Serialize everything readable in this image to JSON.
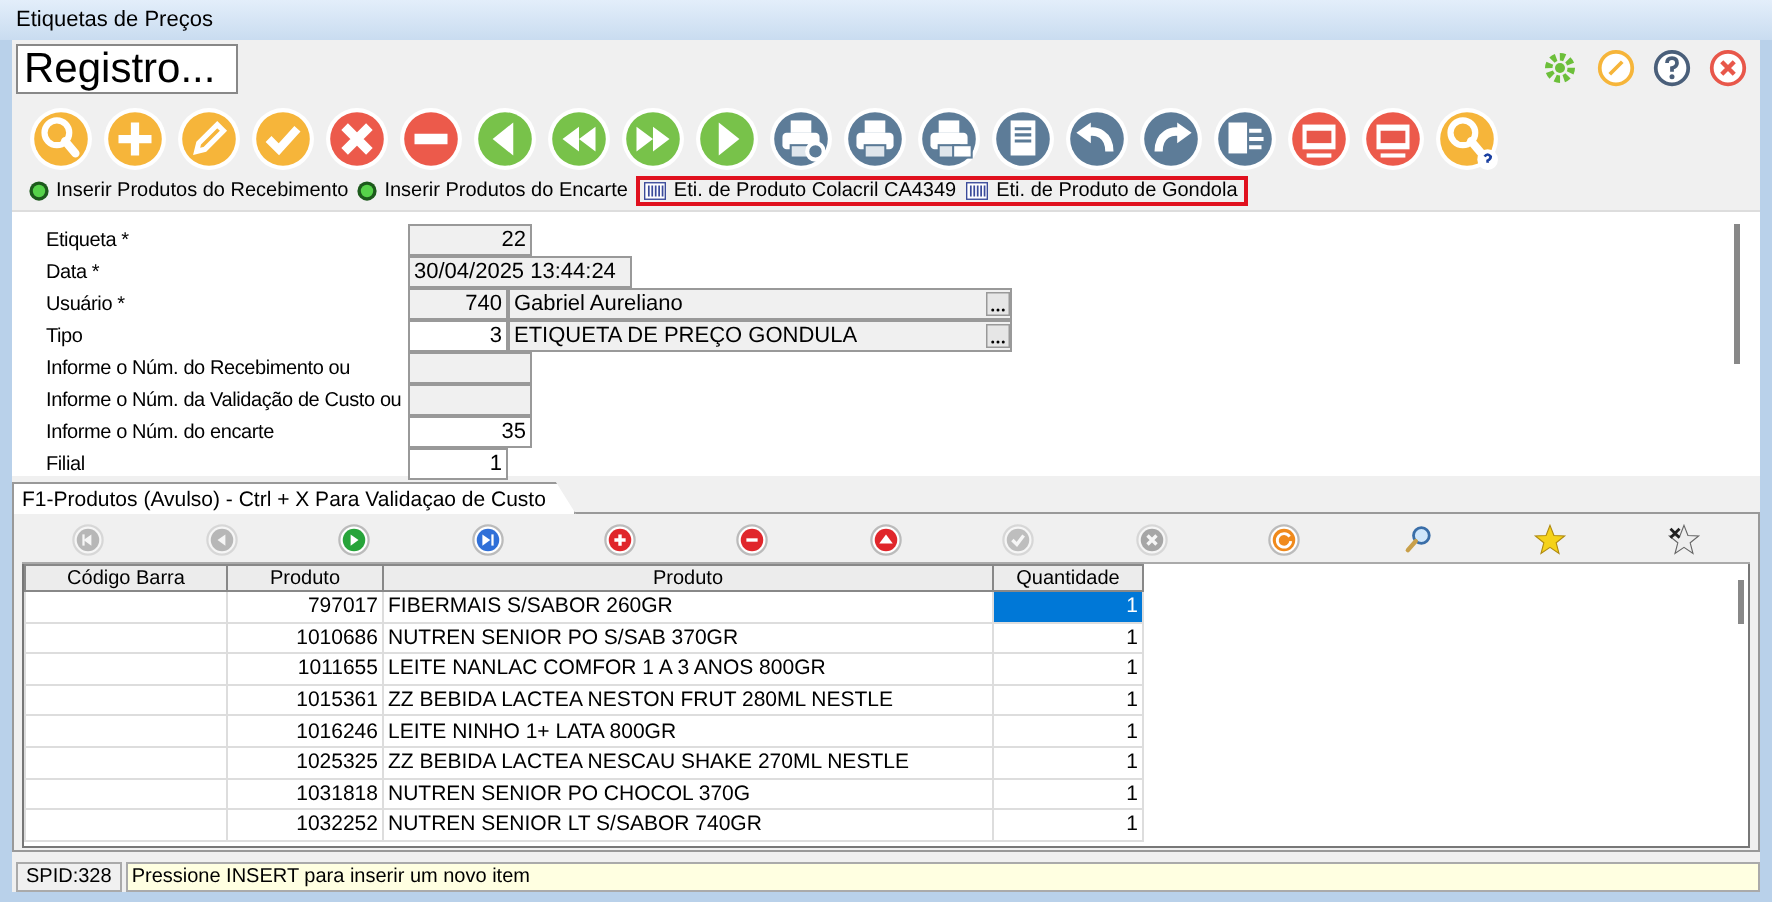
{
  "window": {
    "title": "Etiquetas de Preços"
  },
  "record_label": "Registro...",
  "toolbar": [
    {
      "kind": "search"
    },
    {
      "kind": "add"
    },
    {
      "kind": "edit"
    },
    {
      "kind": "confirm"
    },
    {
      "kind": "cancel"
    },
    {
      "kind": "remove"
    },
    {
      "kind": "previous"
    },
    {
      "kind": "rewind"
    },
    {
      "kind": "fast-forward"
    },
    {
      "kind": "next"
    },
    {
      "kind": "print-preview"
    },
    {
      "kind": "print"
    },
    {
      "kind": "print-mail"
    },
    {
      "kind": "document"
    },
    {
      "kind": "undo"
    },
    {
      "kind": "redo"
    },
    {
      "kind": "export"
    },
    {
      "kind": "edi-out"
    },
    {
      "kind": "edi-in"
    },
    {
      "kind": "search-help"
    }
  ],
  "links": [
    {
      "label": "Inserir Produtos do Recebimento",
      "kind": "dot",
      "highlighted": false
    },
    {
      "label": "Inserir Produtos do Encarte",
      "kind": "dot",
      "highlighted": false
    },
    {
      "label": "Eti. de Produto Colacril CA4349",
      "kind": "grid",
      "highlighted": true
    },
    {
      "label": "Eti. de Produto de Gondola",
      "kind": "grid",
      "highlighted": true
    }
  ],
  "form": [
    {
      "label": "Etiqueta *",
      "value": "22",
      "kind": "short",
      "disabled": true
    },
    {
      "label": "Data *",
      "value": "30/04/2025 13:44:24",
      "kind": "date",
      "disabled": true
    },
    {
      "label": "Usuário *",
      "value": "740",
      "name": "Gabriel Aureliano",
      "kind": "lookup",
      "disabled": true
    },
    {
      "label": "Tipo",
      "value": "3",
      "name": "ETIQUETA DE PREÇO GONDULA",
      "kind": "lookup",
      "disabled": false
    },
    {
      "label": "Informe o Núm. do Recebimento ou",
      "kind": "short",
      "disabled": true
    },
    {
      "label": "Informe o Núm. da Validação de Custo ou",
      "kind": "short",
      "disabled": true
    },
    {
      "label": "Informe o Núm. do encarte",
      "value": "35",
      "kind": "short",
      "disabled": false
    },
    {
      "label": "Filial",
      "value": "1",
      "kind": "code",
      "disabled": false
    }
  ],
  "tab": {
    "label": "F1-Produtos (Avulso) - Ctrl + X Para Validaçao de Custo",
    "selected": true
  },
  "grid_toolbar": [
    {
      "kind": "first",
      "disabled": true
    },
    {
      "kind": "prior",
      "disabled": true
    },
    {
      "kind": "next",
      "disabled": false
    },
    {
      "kind": "last",
      "disabled": false
    },
    {
      "kind": "insert",
      "disabled": false
    },
    {
      "kind": "delete",
      "disabled": false
    },
    {
      "kind": "edit",
      "disabled": false
    },
    {
      "kind": "post",
      "disabled": true
    },
    {
      "kind": "cancel",
      "disabled": true
    },
    {
      "kind": "refresh",
      "disabled": false
    },
    {
      "kind": "search",
      "disabled": false
    },
    {
      "kind": "bookmark",
      "disabled": false
    },
    {
      "kind": "clear-bookmark",
      "disabled": false
    }
  ],
  "table": {
    "columns": [
      "Código Barra",
      "Produto",
      "Produto",
      "Quantidade"
    ],
    "rows": [
      {
        "product_code": "797017",
        "product": "FIBERMAIS S/SABOR 260GR",
        "quantity": "1",
        "selected": true
      },
      {
        "product_code": "1010686",
        "product": "NUTREN SENIOR PO S/SAB 370GR",
        "quantity": "1",
        "selected": false
      },
      {
        "product_code": "1011655",
        "product": "LEITE NANLAC COMFOR 1 A 3 ANOS 800GR",
        "quantity": "1",
        "selected": false
      },
      {
        "product_code": "1015361",
        "product": "ZZ BEBIDA LACTEA NESTON FRUT 280ML NESTLE",
        "quantity": "1",
        "selected": false
      },
      {
        "product_code": "1016246",
        "product": "LEITE NINHO 1+ LATA 800GR",
        "quantity": "1",
        "selected": false
      },
      {
        "product_code": "1025325",
        "product": "ZZ BEBIDA LACTEA NESCAU SHAKE 270ML NESTLE",
        "quantity": "1",
        "selected": false
      },
      {
        "product_code": "1031818",
        "product": "NUTREN SENIOR PO CHOCOL 370G",
        "quantity": "1",
        "selected": false
      },
      {
        "product_code": "1032252",
        "product": "NUTREN SENIOR LT S/SABOR 740GR",
        "quantity": "1",
        "selected": false
      }
    ]
  },
  "status_bar": {
    "spid": "SPID:328",
    "message": "Pressione INSERT para inserir um novo item"
  }
}
